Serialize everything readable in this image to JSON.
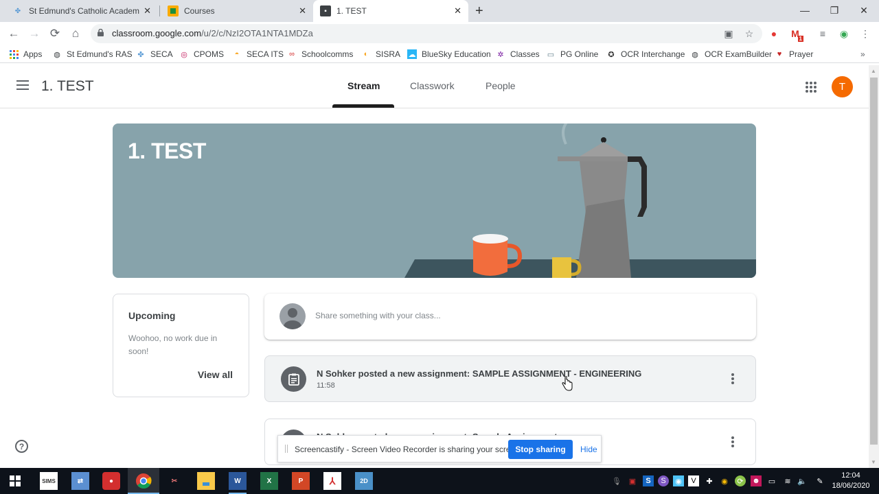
{
  "browser": {
    "tabs": [
      {
        "label": "St Edmund's Catholic Academy |",
        "icon": "st-edmunds-crest-icon",
        "active": false
      },
      {
        "label": "Courses",
        "icon": "google-classroom-icon",
        "active": false
      },
      {
        "label": "1. TEST",
        "icon": "classroom-class-icon",
        "active": true
      }
    ],
    "new_tab": "+",
    "close_glyph": "✕",
    "window_controls": {
      "minimize": "—",
      "maximize": "❐",
      "close": "✕"
    },
    "nav": {
      "back": "←",
      "forward": "→",
      "reload": "⟳",
      "home": "⌂"
    },
    "url_host": "classroom.google.com",
    "url_path": "/u/2/c/NzI2OTA1NTA1MDZa",
    "bookmarks": [
      {
        "label": "Apps",
        "icon": "apps-grid-icon"
      },
      {
        "label": "St Edmund's RAS",
        "icon": "globe-icon"
      },
      {
        "label": "SECA",
        "icon": "seca-crest-icon"
      },
      {
        "label": "CPOMS",
        "icon": "cpoms-icon"
      },
      {
        "label": "SECA ITS",
        "icon": "its-helmet-icon"
      },
      {
        "label": "Schoolcomms",
        "icon": "schoolcomms-icon"
      },
      {
        "label": "SISRA",
        "icon": "sisra-icon"
      },
      {
        "label": "BlueSky Education",
        "icon": "bluesky-icon"
      },
      {
        "label": "Classes",
        "icon": "classes-icon"
      },
      {
        "label": "PG Online",
        "icon": "pg-online-icon"
      },
      {
        "label": "OCR Interchange",
        "icon": "ocr-star-icon"
      },
      {
        "label": "OCR ExamBuilder",
        "icon": "globe-icon"
      },
      {
        "label": "Prayer",
        "icon": "heart-icon"
      }
    ],
    "bookmarks_overflow": "»",
    "gmail_badge": "1"
  },
  "classroom": {
    "class_name": "1. TEST",
    "tabs": [
      {
        "label": "Stream",
        "active": true
      },
      {
        "label": "Classwork",
        "active": false
      },
      {
        "label": "People",
        "active": false
      }
    ],
    "avatar_letter": "T",
    "banner_title": "1. TEST",
    "upcoming": {
      "heading": "Upcoming",
      "message": "Woohoo, no work due in soon!",
      "view_all": "View all"
    },
    "share_placeholder": "Share something with your class...",
    "posts": [
      {
        "text": "N Sohker posted a new assignment: SAMPLE ASSIGNMENT - ENGINEERING",
        "time": "11:58"
      },
      {
        "text": "N Sohker posted a new assignment: Sample Assignment",
        "time": ""
      }
    ],
    "help": "?"
  },
  "screencastify": {
    "message": "Screencastify - Screen Video Recorder is sharing your screen.",
    "stop_label": "Stop sharing",
    "hide_label": "Hide"
  },
  "taskbar": {
    "apps": [
      "Start",
      "SIMS",
      "Transfer",
      "Camera",
      "Chrome",
      "Snipping Tool",
      "File Explorer",
      "Word",
      "Excel",
      "PowerPoint",
      "Acrobat",
      "2D Design"
    ],
    "sims_label": "SIMS",
    "time": "12:04",
    "date": "18/06/2020"
  },
  "colors": {
    "banner": "#87a3ab",
    "avatar": "#f56a00",
    "stop_button": "#1a73e8"
  }
}
